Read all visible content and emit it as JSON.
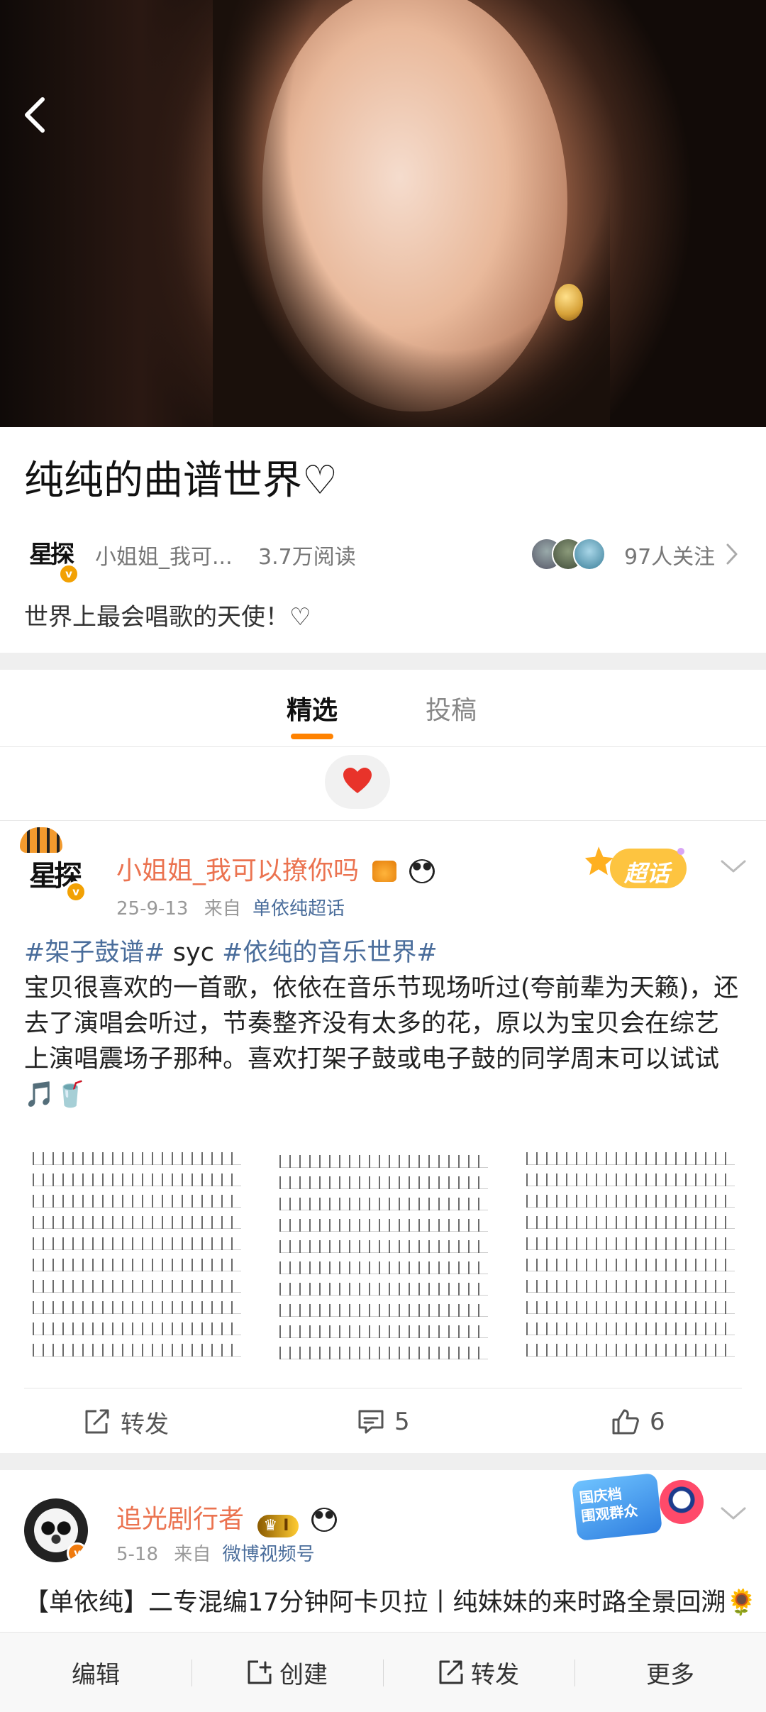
{
  "topic": {
    "title": "纯纯的曲谱世界♡",
    "host_name": "小姐姐_我可...",
    "host_avatar_text": "星探",
    "reads": "3.7万阅读",
    "followers": "97人关注",
    "description": "世界上最会唱歌的天使！♡"
  },
  "tabs": [
    {
      "label": "精选",
      "active": true
    },
    {
      "label": "投稿",
      "active": false
    }
  ],
  "posts": [
    {
      "author": "小姐姐_我可以撩你吗",
      "avatar_text": "星探",
      "date": "25-9-13",
      "from_label": "来自",
      "source": "单依纯超话",
      "tag_badge": "超话",
      "text": {
        "tag1": "#架子鼓谱#",
        "mid": " syc ",
        "tag2": "#依纯的音乐世界#",
        "body": "宝贝很喜欢的一首歌，依依在音乐节现场听过(夸前辈为天籁)，还去了演唱会听过，节奏整齐没有太多的花，原以为宝贝会在综艺上演唱震场子那种。喜欢打架子鼓或电子鼓的同学周末可以试试🎵🥤"
      },
      "actions": {
        "repost": "转发",
        "comments": "5",
        "likes": "6"
      }
    },
    {
      "author": "追光剧行者",
      "level_badge": "I",
      "date": "5-18",
      "from_label": "来自",
      "source": "微博视频号",
      "tag_badge_line1": "国庆档",
      "tag_badge_line2": "围观群众",
      "text": "【单依纯】二专混编17分钟阿卡贝拉丨纯妹妹的来时路全景回溯🌻 #单依纯# #纯妹妹# #阿卡贝拉纯人声#"
    }
  ],
  "bottom_bar": {
    "edit": "编辑",
    "create": "创建",
    "repost": "转发",
    "more": "更多"
  },
  "colors": {
    "accent": "#ff8200",
    "author_name": "#eb7350",
    "link": "#4a6d9b",
    "heart": "#e8332a"
  }
}
